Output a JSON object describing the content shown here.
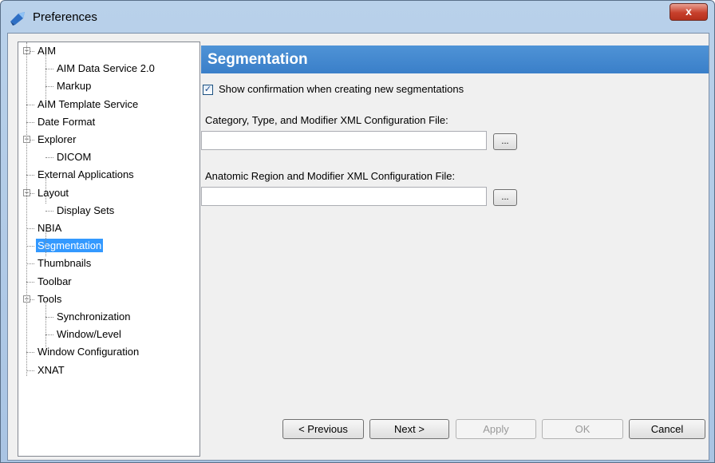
{
  "window": {
    "title": "Preferences",
    "close_label": "x"
  },
  "tree": {
    "items": [
      {
        "label": "AIM",
        "expandable": true,
        "expanded": true
      },
      {
        "label": "AIM Data Service 2.0"
      },
      {
        "label": "Markup"
      },
      {
        "label": "AIM Template Service"
      },
      {
        "label": "Date Format"
      },
      {
        "label": "Explorer",
        "expandable": true,
        "expanded": true
      },
      {
        "label": "DICOM"
      },
      {
        "label": "External Applications"
      },
      {
        "label": "Layout",
        "expandable": true,
        "expanded": true
      },
      {
        "label": "Display Sets"
      },
      {
        "label": "NBIA"
      },
      {
        "label": "Segmentation",
        "selected": true
      },
      {
        "label": "Thumbnails"
      },
      {
        "label": "Toolbar"
      },
      {
        "label": "Tools",
        "expandable": true,
        "expanded": true
      },
      {
        "label": "Synchronization"
      },
      {
        "label": "Window/Level"
      },
      {
        "label": "Window Configuration"
      },
      {
        "label": "XNAT"
      }
    ],
    "expander_symbol": "−"
  },
  "panel": {
    "title": "Segmentation",
    "checkbox_label": "Show confirmation when creating new segmentations",
    "checkbox_checked": true,
    "checkbox_mark": "✓",
    "field1_label": "Category, Type, and Modifier XML Configuration File:",
    "field1_value": "",
    "field2_label": "Anatomic Region and Modifier XML Configuration File:",
    "field2_value": "",
    "browse_label": "..."
  },
  "buttons": {
    "previous": "< Previous",
    "next": "Next >",
    "apply": "Apply",
    "ok": "OK",
    "cancel": "Cancel"
  },
  "colors": {
    "header_bg": "#3a7fc9",
    "selection_bg": "#3399ff",
    "close_button": "#c7402c"
  }
}
